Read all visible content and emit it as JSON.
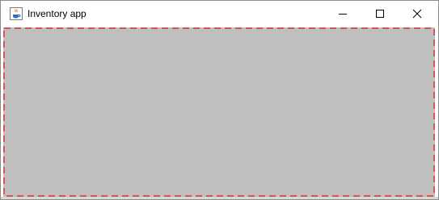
{
  "window": {
    "title": "Inventory app",
    "app_icon": "java-coffee-cup-icon",
    "controls": {
      "minimize": "minimize-icon",
      "maximize": "maximize-icon",
      "close": "close-icon"
    }
  },
  "content": {
    "background_color": "#c0c0c0",
    "border_color": "#e03030",
    "border_style": "dashed"
  }
}
